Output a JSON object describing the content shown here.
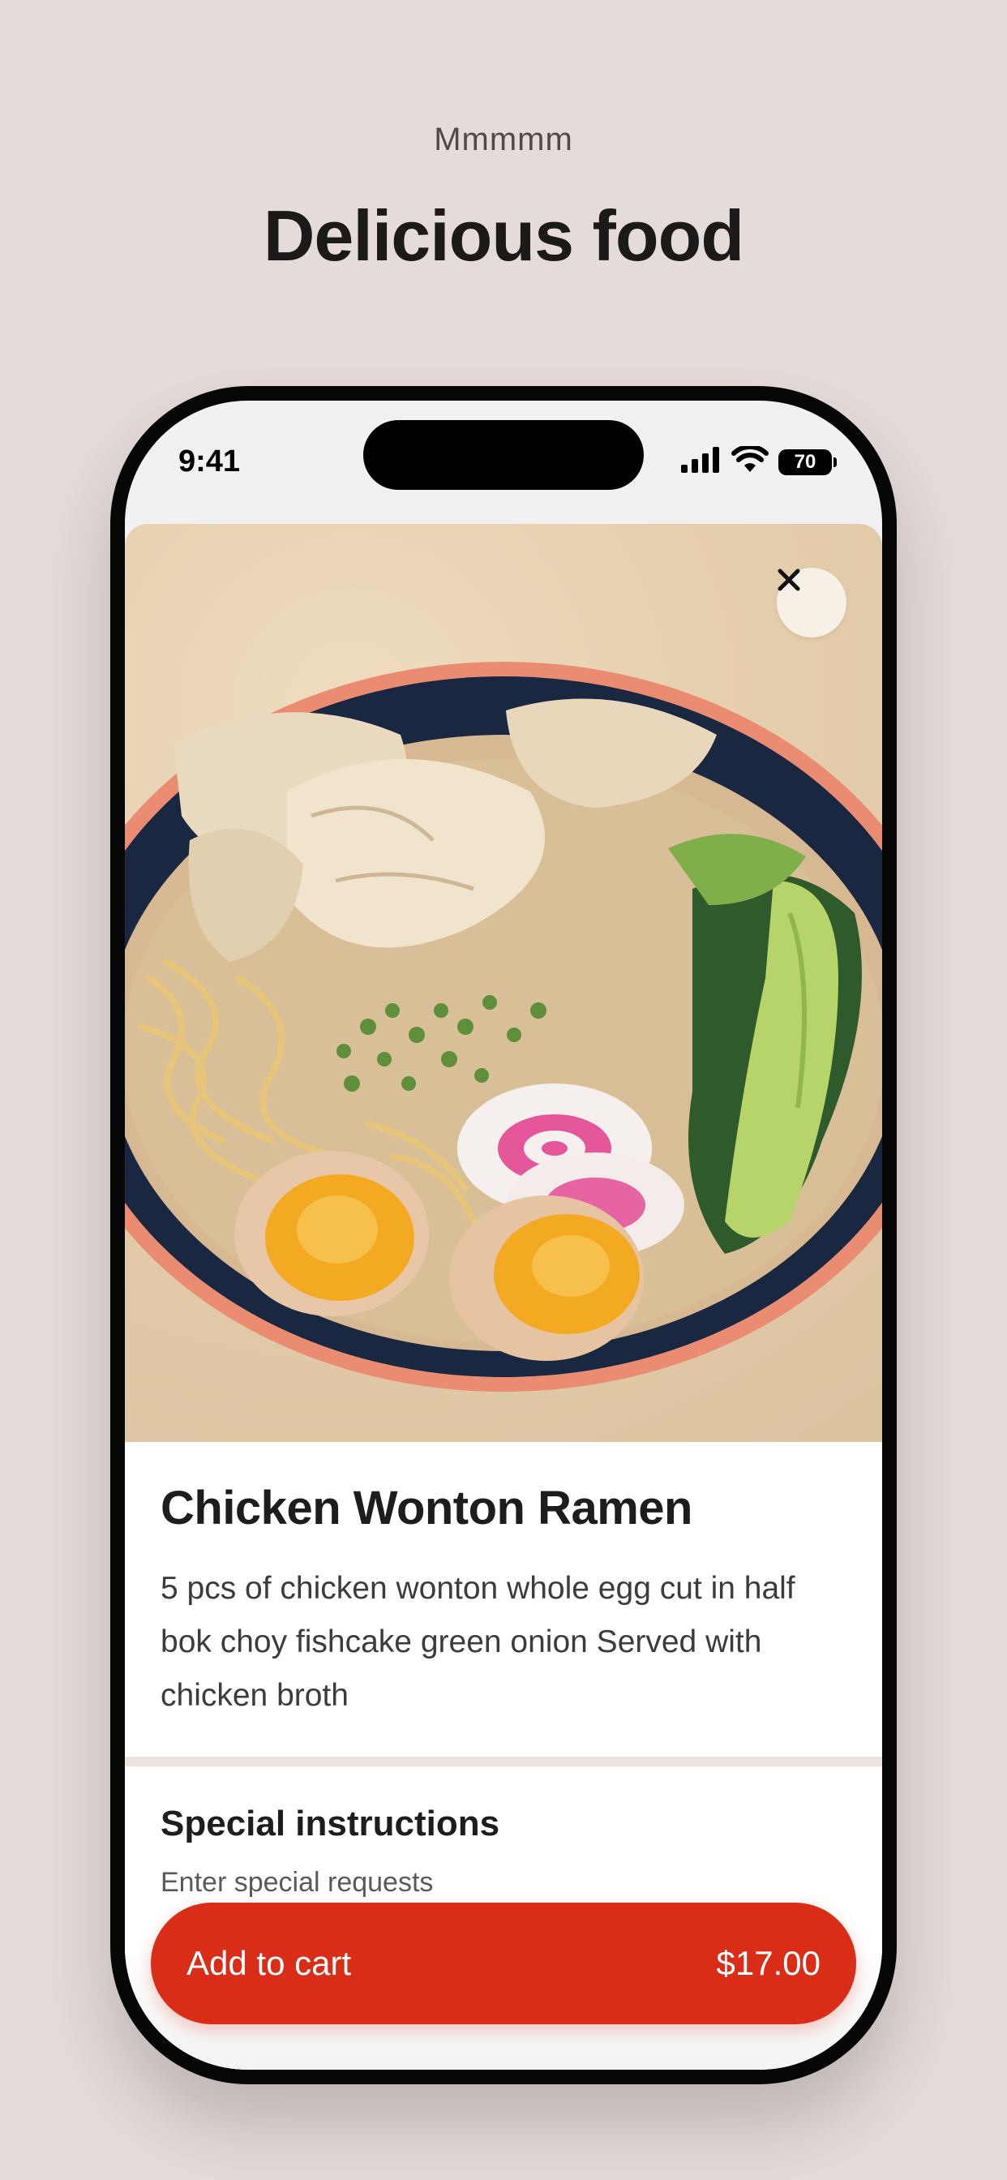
{
  "page": {
    "eyebrow": "Mmmmm",
    "headline": "Delicious food"
  },
  "status_bar": {
    "time": "9:41",
    "battery": "70"
  },
  "item": {
    "image_alt": "Chicken wonton ramen bowl",
    "title": "Chicken Wonton Ramen",
    "description": "5 pcs of chicken wonton whole egg cut in half bok choy fishcake green onion Served with chicken broth"
  },
  "instructions": {
    "title": "Special instructions",
    "placeholder": "Enter special requests"
  },
  "cart": {
    "label": "Add to cart",
    "price": "$17.00"
  },
  "colors": {
    "background": "#e5dcda",
    "accent": "#d92d18",
    "text": "#1d1d1d"
  }
}
